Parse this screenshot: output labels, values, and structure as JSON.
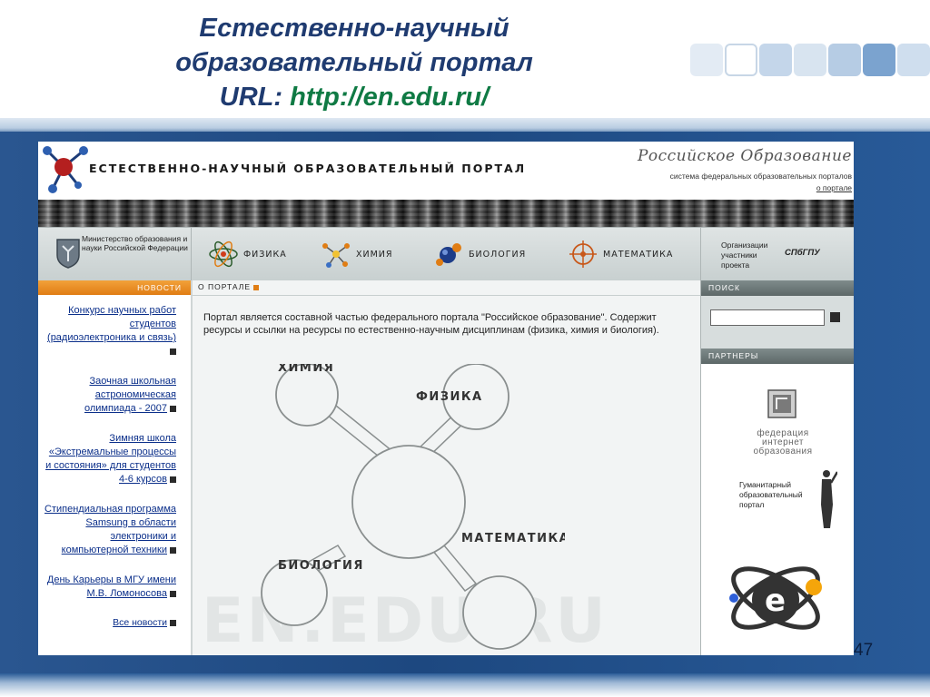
{
  "slide": {
    "title_line1": "Естественно-научный",
    "title_line2": "образовательный портал",
    "url_label": "URL: ",
    "url": "http://en.edu.ru/",
    "page_number": "47"
  },
  "site": {
    "name": "ЕСТЕСТВЕННО-НАУЧНЫЙ ОБРАЗОВАТЕЛЬНЫЙ ПОРТАЛ",
    "ro_title": "Российское Образование",
    "ro_subtitle": "система федеральных образовательных порталов",
    "ro_link": "о портале",
    "ministry": "Министерство образования и науки Российской Федерации",
    "nav": [
      {
        "label": "ФИЗИКА",
        "icon": "atom-icon"
      },
      {
        "label": "ХИМИЯ",
        "icon": "molecule-icon"
      },
      {
        "label": "БИОЛОГИЯ",
        "icon": "biology-icon"
      },
      {
        "label": "МАТЕМАТИКА",
        "icon": "math-crosshair-icon"
      }
    ],
    "org_label": "Организации участники проекта",
    "org_logo": "СПбГПУ"
  },
  "news": {
    "header": "НОВОСТИ",
    "items": [
      "Конкурс научных работ студентов (радиоэлектроника и связь)",
      "Заочная школьная астрономическая олимпиада - 2007",
      "Зимняя школа «Экстремальные процессы и состояния» для студентов 4-6 курсов",
      "Стипендиальная программа Samsung в области электроники и компьютерной техники",
      "День Карьеры в МГУ имени М.В. Ломоносова"
    ],
    "all_news": "Все новости"
  },
  "center": {
    "tab": "О ПОРТАЛЕ",
    "intro": "Портал является составной частью федерального портала \"Российское образование\". Содержит ресурсы и ссылки на ресурсы по естественно-научным дисциплинам (физика, химия и биология).",
    "watermark": "EN.EDU.RU",
    "diagram": {
      "chemistry": "ХИМИЯ",
      "physics": "ФИЗИКА",
      "mathematics": "МАТЕМАТИКА",
      "biology": "БИОЛОГИЯ"
    }
  },
  "right": {
    "search_header": "ПОИСК",
    "partners_header": "ПАРТНЕРЫ",
    "fed_text": "федерация интернет образования",
    "hum_text": "Гуманитарный образовательный портал"
  },
  "colors": {
    "title_blue": "#1f3b70",
    "url_green": "#0f7a44",
    "news_orange": "#e07d14",
    "link_blue": "#0b2f8a"
  }
}
